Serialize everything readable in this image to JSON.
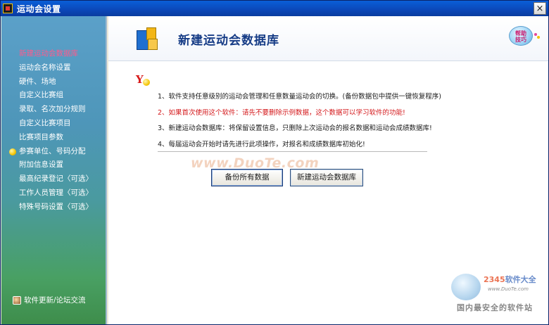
{
  "window": {
    "title": "运动会设置",
    "close_glyph": "×"
  },
  "sidebar": {
    "items": [
      {
        "label": "新建运动会数据库",
        "active": true
      },
      {
        "label": "运动会名称设置"
      },
      {
        "label": "硬件、场地"
      },
      {
        "label": "自定义比赛组"
      },
      {
        "label": "录取、名次加分规则"
      },
      {
        "label": "自定义比赛项目"
      },
      {
        "label": "比赛项目参数"
      },
      {
        "label": "参赛单位、号码分配",
        "bullet": true
      },
      {
        "label": "附加信息设置"
      },
      {
        "label": "最高纪录登记〈可选〉"
      },
      {
        "label": "工作人员管理〈可选〉"
      },
      {
        "label": "特殊号码设置〈可选〉"
      }
    ],
    "footer_label": "软件更新/论坛交流"
  },
  "main": {
    "title": "新建运动会数据库",
    "help_label_line1": "帮助",
    "help_label_line2": "技巧",
    "logo_letter": "Y",
    "lines": [
      {
        "text": "1、软件支持任意级别的运动会管理和任意数量运动会的切换。(备份数据包中提供一键恢复程序)",
        "red": false
      },
      {
        "text": "2、如果首次使用这个软件：请先不要删除示例数据，这个数据可以学习软件的功能!",
        "red": true
      },
      {
        "text": "3、新建运动会数据库：将保留设置信息，只删除上次运动会的报名数据和运动会成绩数据库!",
        "red": false
      },
      {
        "text": "4、每届运动会开始时请先进行此项操作，对报名和成绩数据库初始化!",
        "red": false
      }
    ],
    "buttons": {
      "backup_label": "备份所有数据",
      "newdb_label": "新建运动会数据库"
    },
    "watermark_text": "www.DuoTe.com"
  },
  "corner": {
    "brand_prefix": "2345",
    "brand_suffix": "软件大全",
    "url": "www.DuoTe.com",
    "slogan": "国内最安全的软件站"
  },
  "colors": {
    "title_bar": "#0b47b8",
    "active_nav": "#ff5a8c",
    "warning_text": "#d4181b",
    "heading": "#163c86"
  },
  "icons": {
    "app": "app-icon",
    "close": "close-icon",
    "database": "database-icon",
    "help": "help-icon",
    "logo": "y-logo-icon",
    "bullet": "bullet-icon",
    "footer": "update-icon"
  }
}
